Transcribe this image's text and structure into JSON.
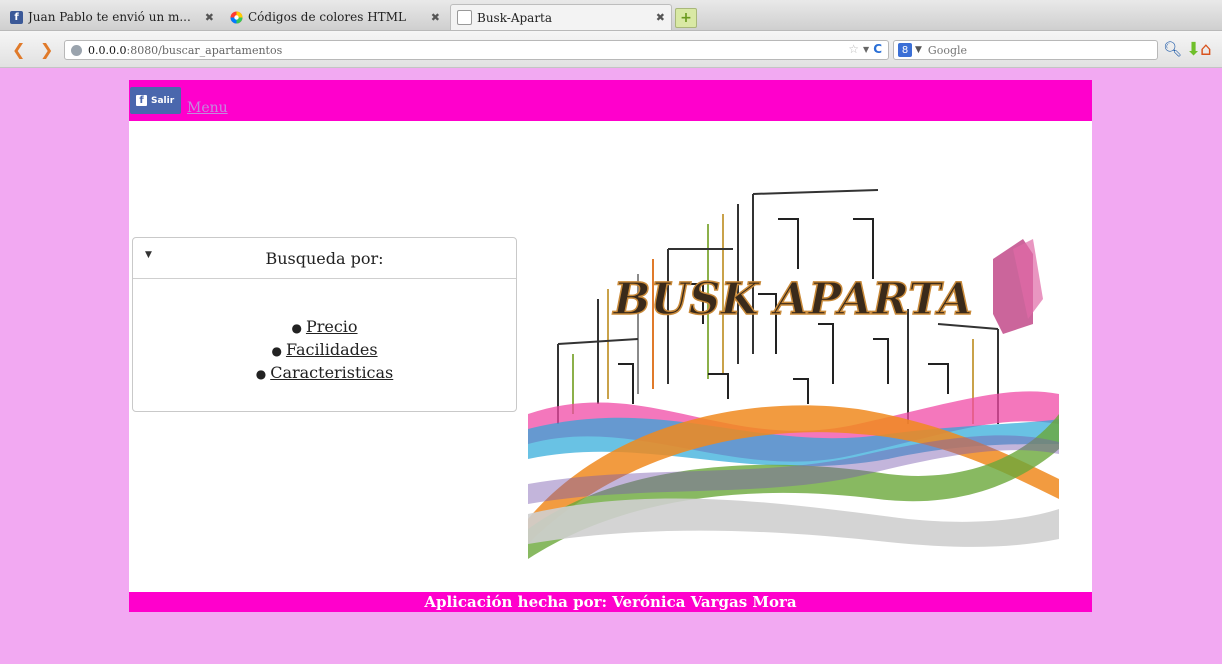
{
  "browser": {
    "tabs": [
      {
        "title": "Juan Pablo te envió un m...",
        "icon": "facebook-icon",
        "active": false
      },
      {
        "title": "Códigos de colores HTML",
        "icon": "color-wheel-icon",
        "active": false
      },
      {
        "title": "Busk-Aparta",
        "icon": "blank-page-icon",
        "active": true
      }
    ],
    "url_host": "0.0.0.0",
    "url_rest": ":8080/buscar_apartamentos",
    "search_engine": "8",
    "search_placeholder": "Google"
  },
  "header": {
    "fb_button_label": "Salir",
    "menu_label": "Menu"
  },
  "search_panel": {
    "title": "Busqueda por:",
    "items": [
      "Precio",
      "Facilidades",
      "Caracteristicas"
    ]
  },
  "hero": {
    "logo_text": "BUSK APARTA"
  },
  "footer": {
    "text": "Aplicación hecha por: Verónica Vargas Mora"
  },
  "colors": {
    "page_bg": "#f2a9f2",
    "band": "#ff00cc",
    "fb_blue": "#4a67ad",
    "menu_link": "#c28bde"
  }
}
